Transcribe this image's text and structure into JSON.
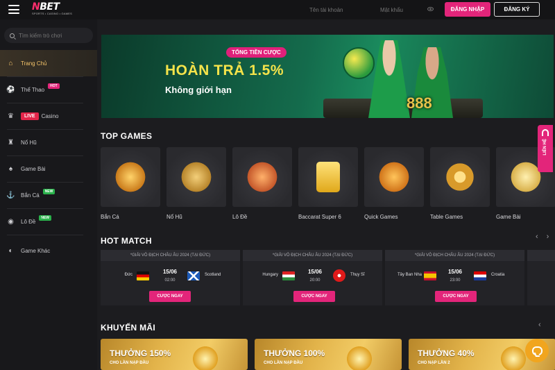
{
  "header": {
    "logo_brand_prefix": "N",
    "logo_brand": "BET",
    "logo_tagline": "SPORTS • CASINO • GAMES",
    "username_placeholder": "Tên tài khoản",
    "password_placeholder": "Mật khẩu",
    "login_label": "ĐĂNG NHẬP",
    "register_label": "ĐĂNG KÝ"
  },
  "sidebar": {
    "search_placeholder": "Tìm kiếm trò chơi",
    "items": [
      {
        "label": "Trang Chủ",
        "icon": "home-icon",
        "active": true
      },
      {
        "label": "Thể Thao",
        "icon": "soccer-ball-icon",
        "badge": "HOT"
      },
      {
        "label": "Casino",
        "icon": "dealer-icon",
        "badge": "LIVE"
      },
      {
        "label": "Nổ Hũ",
        "icon": "jackpot-icon"
      },
      {
        "label": "Game Bài",
        "icon": "cards-icon"
      },
      {
        "label": "Bắn Cá",
        "icon": "fish-icon",
        "badge": "NEW"
      },
      {
        "label": "Lô Đề",
        "icon": "lottery-icon",
        "badge": "NEW"
      },
      {
        "label": "Game Khác",
        "icon": "gamepad-icon"
      }
    ]
  },
  "banner": {
    "pill": "TỔNG TIỀN CƯỢC",
    "headline": "HOÀN TRẢ 1.5%",
    "subline": "Không giới hạn",
    "number": "888"
  },
  "top_games": {
    "title": "TOP GAMES",
    "items": [
      {
        "label": "Bắn Cá",
        "color": "#e8a030"
      },
      {
        "label": "Nổ Hũ",
        "color": "#d9a23a"
      },
      {
        "label": "Lô Đề",
        "color": "#e37a3a"
      },
      {
        "label": "Baccarat Super 6",
        "color": "#f0c03a"
      },
      {
        "label": "Quick Games",
        "color": "#e89a2a"
      },
      {
        "label": "Table Games",
        "color": "#e0a83a"
      },
      {
        "label": "Game Bài",
        "color": "#e8c05a"
      }
    ]
  },
  "hot_match": {
    "title": "HOT MATCH",
    "bet_label": "CƯỢC NGAY",
    "matches": [
      {
        "league": "*GIẢI VÔ ĐỊCH CHÂU ÂU 2024 (TẠI ĐỨC)",
        "home": "Đức",
        "away": "Scotland",
        "date": "15/06",
        "time": "02:00",
        "home_flag": "germany-flag-icon",
        "away_flag": "scotland-flag-icon"
      },
      {
        "league": "*GIẢI VÔ ĐỊCH CHÂU ÂU 2024 (TẠI ĐỨC)",
        "home": "Hungary",
        "away": "Thụy Sĩ",
        "date": "15/06",
        "time": "20:00",
        "home_flag": "hungary-flag-icon",
        "away_flag": "switzerland-flag-icon"
      },
      {
        "league": "*GIẢI VÔ ĐỊCH CHÂU ÂU 2024 (TẠI ĐỨC)",
        "home": "Tây Ban Nha",
        "away": "Croatia",
        "date": "15/06",
        "time": "23:00",
        "home_flag": "spain-flag-icon",
        "away_flag": "croatia-flag-icon"
      }
    ]
  },
  "promotions": {
    "title": "KHUYẾN MÃI",
    "items": [
      {
        "title": "THƯỞNG 150%",
        "sub": "CHO LẦN NẠP ĐẦU"
      },
      {
        "title": "THƯỞNG 100%",
        "sub": "CHO LẦN NẠP ĐẦU"
      },
      {
        "title": "THƯỞNG 40%",
        "sub": "CHO NẠP LẦN 2"
      }
    ]
  },
  "contact": {
    "label": "LIÊN HỆ"
  },
  "colors": {
    "accent": "#e3257a",
    "active_nav": "#f4c46a",
    "chat": "#f1a51e"
  }
}
